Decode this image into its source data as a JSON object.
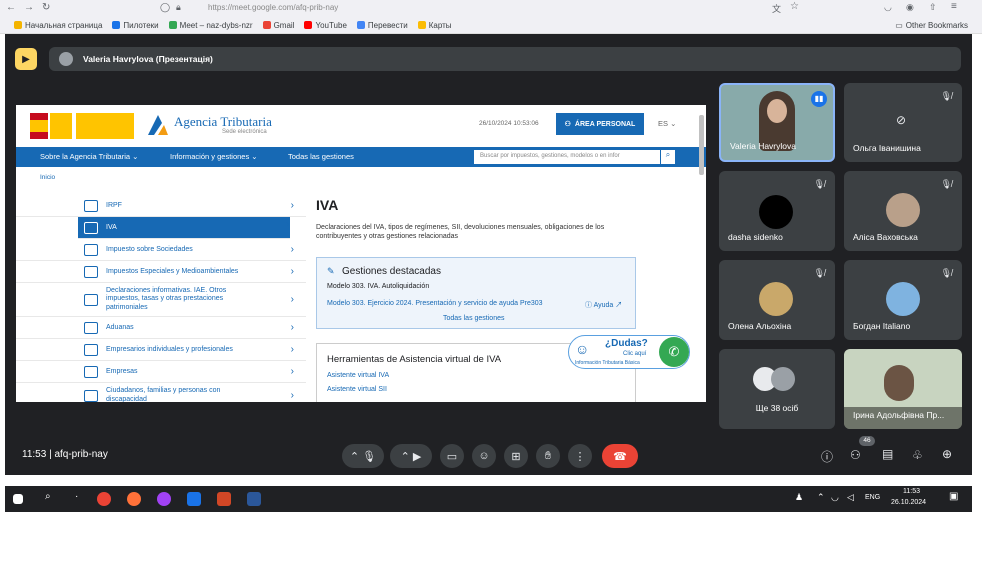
{
  "browser": {
    "url": "https://meet.google.com/afq-prib-nay",
    "bookmarks": [
      "Начальная страница",
      "Пилотеки",
      "Meet – naz-dybs-nzr",
      "Gmail",
      "YouTube",
      "Перевести",
      "Карты"
    ],
    "other_bookmarks": "Other Bookmarks"
  },
  "meet": {
    "presenter": "Valeria Havrylova (Презентація)",
    "time": "11:53",
    "meeting_code": "afq-prib-nay",
    "participant_count": "46",
    "participants": [
      {
        "name": "Valeria Havrylova"
      },
      {
        "name": "Ольга Іванишина"
      },
      {
        "name": "dasha sidenko"
      },
      {
        "name": "Аліса Ваховська"
      },
      {
        "name": "Олена Альохіна"
      },
      {
        "name": "Богдан Italiano"
      },
      {
        "name": "Ще 38 осіб"
      },
      {
        "name": "Ірина Адольфівна Пр..."
      }
    ],
    "colors": {
      "end_call": "#ea4335",
      "accent": "#8ab4f8"
    }
  },
  "shared_page": {
    "site_name": "Agencia Tributaria",
    "site_sub": "Sede electrónica",
    "date": "26/10/2024 10:53:06",
    "area_personal": "ÁREA PERSONAL",
    "lang": "ES",
    "nav": [
      "Sobre la Agencia Tributaria",
      "Información y gestiones",
      "Todas las gestiones"
    ],
    "search_placeholder": "Buscar por impuestos, gestiones, modelos o en infor",
    "breadcrumb": "Inicio",
    "menu": [
      "IRPF",
      "IVA",
      "Impuesto sobre Sociedades",
      "Impuestos Especiales y Medioambientales",
      "Declaraciones informativas. IAE. Otros impuestos, tasas y otras prestaciones patrimoniales",
      "Aduanas",
      "Empresarios individuales y profesionales",
      "Empresas",
      "Ciudadanos, familias y personas con discapacidad"
    ],
    "title": "IVA",
    "description": "Declaraciones del IVA, tipos de regímenes, SII, devoluciones mensuales, obligaciones de los contribuyentes y otras gestiones relacionadas",
    "gestiones_title": "Gestiones destacadas",
    "gestiones_item1": "Modelo 303. IVA. Autoliquidación",
    "gestiones_item2": "Modelo 303. Ejercicio 2024. Presentación y servicio de ayuda Pre303",
    "ayuda": "Ayuda",
    "todas": "Todas las gestiones",
    "herramientas_title": "Herramientas de Asistencia virtual de IVA",
    "herr_item1": "Asistente virtual IVA",
    "herr_item2": "Asistente virtual SII",
    "dudas": "¿Dudas?",
    "dudas_sub": "Clic aquí",
    "dudas_info": "Información Tributaria Básica"
  },
  "taskbar": {
    "lang": "ENG",
    "time": "11:53",
    "date": "26.10.2024"
  }
}
